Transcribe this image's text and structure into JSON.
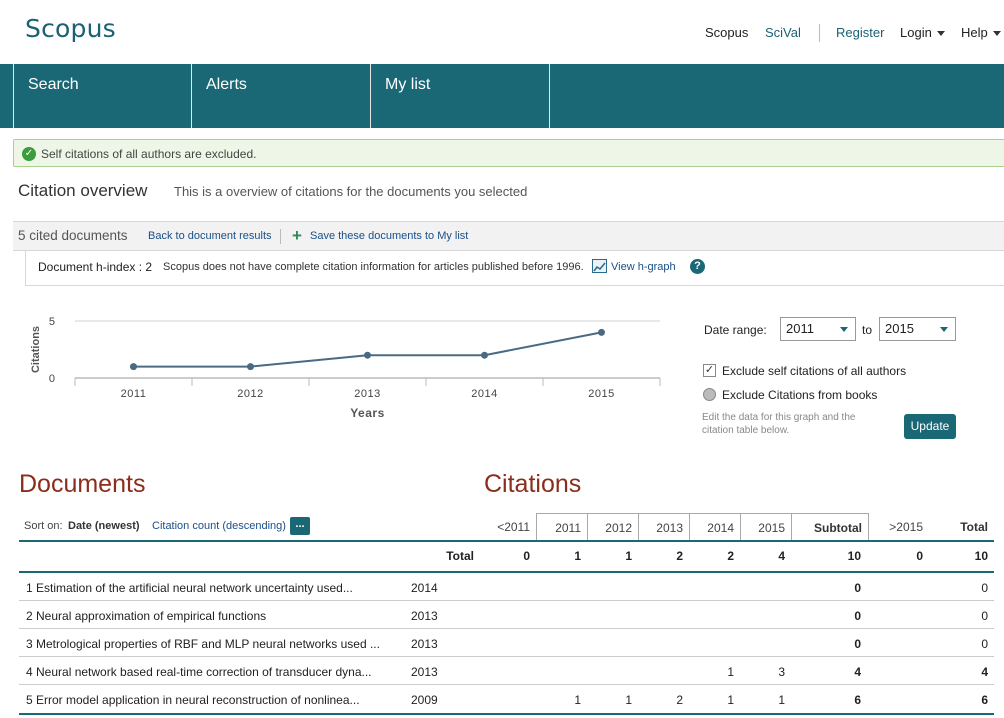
{
  "header": {
    "logo": "Scopus",
    "links": {
      "scopus": "Scopus",
      "scival": "SciVal",
      "register": "Register",
      "login": "Login",
      "help": "Help"
    }
  },
  "nav": {
    "tabs": [
      "Search",
      "Alerts",
      "My list"
    ]
  },
  "alert": {
    "text": "Self citations of all authors are excluded."
  },
  "page": {
    "title": "Citation overview",
    "subtitle": "This is a overview of citations for the documents you selected"
  },
  "toolbar": {
    "cited": "5 cited documents",
    "back": "Back to document results",
    "save": "Save these documents to My list"
  },
  "hindex": {
    "label": "Document h-index : 2",
    "note": "Scopus does not have complete citation information for articles published before 1996.",
    "view": "View h-graph",
    "help": "?"
  },
  "chart_data": {
    "type": "line",
    "x": [
      "2011",
      "2012",
      "2013",
      "2014",
      "2015"
    ],
    "values": [
      1,
      1,
      2,
      2,
      4
    ],
    "xlabel": "Years",
    "ylabel": "Citations",
    "ylim": [
      0,
      5
    ],
    "yticks": [
      "0",
      "5"
    ],
    "grid": true,
    "colors": {
      "line": "#4a6a84",
      "grid": "#d0d0d0"
    }
  },
  "daterange": {
    "label": "Date range:",
    "from": "2011",
    "to_label": "to",
    "to": "2015",
    "exclude_self": "Exclude self citations of all authors",
    "exclude_self_checked": true,
    "exclude_books": "Exclude Citations from books",
    "exclude_books_checked": false,
    "note": "Edit the data for this graph and the citation table below.",
    "update": "Update"
  },
  "documents": {
    "heading": "Documents",
    "sort_on": "Sort on:",
    "sort_active": "Date (newest)",
    "sort_alt": "Citation count (descending)",
    "more": "..."
  },
  "citations": {
    "heading": "Citations",
    "columns": [
      "<2011",
      "2011",
      "2012",
      "2013",
      "2014",
      "2015",
      "Subtotal",
      ">2015",
      "Total"
    ],
    "total_row": {
      "label": "Total",
      "values": [
        "0",
        "1",
        "1",
        "2",
        "2",
        "4",
        "10",
        "0",
        "10"
      ]
    },
    "rows": [
      {
        "n": "1",
        "title": "Estimation of the artificial neural network uncertainty used...",
        "year": "2014",
        "values": [
          "",
          "",
          "",
          "",
          "",
          "",
          "0",
          "",
          "0"
        ]
      },
      {
        "n": "2",
        "title": "Neural approximation of empirical functions",
        "year": "2013",
        "values": [
          "",
          "",
          "",
          "",
          "",
          "",
          "0",
          "",
          "0"
        ]
      },
      {
        "n": "3",
        "title": "Metrological properties of RBF and MLP neural networks used ...",
        "year": "2013",
        "values": [
          "",
          "",
          "",
          "",
          "",
          "",
          "0",
          "",
          "0"
        ]
      },
      {
        "n": "4",
        "title": "Neural network based real-time correction of transducer dyna...",
        "year": "2013",
        "values": [
          "",
          "",
          "",
          "",
          "1",
          "3",
          "4",
          "",
          "4"
        ]
      },
      {
        "n": "5",
        "title": "Error model application in neural reconstruction of nonlinea...",
        "year": "2009",
        "values": [
          "",
          "1",
          "1",
          "2",
          "1",
          "1",
          "6",
          "",
          "6"
        ]
      }
    ]
  }
}
